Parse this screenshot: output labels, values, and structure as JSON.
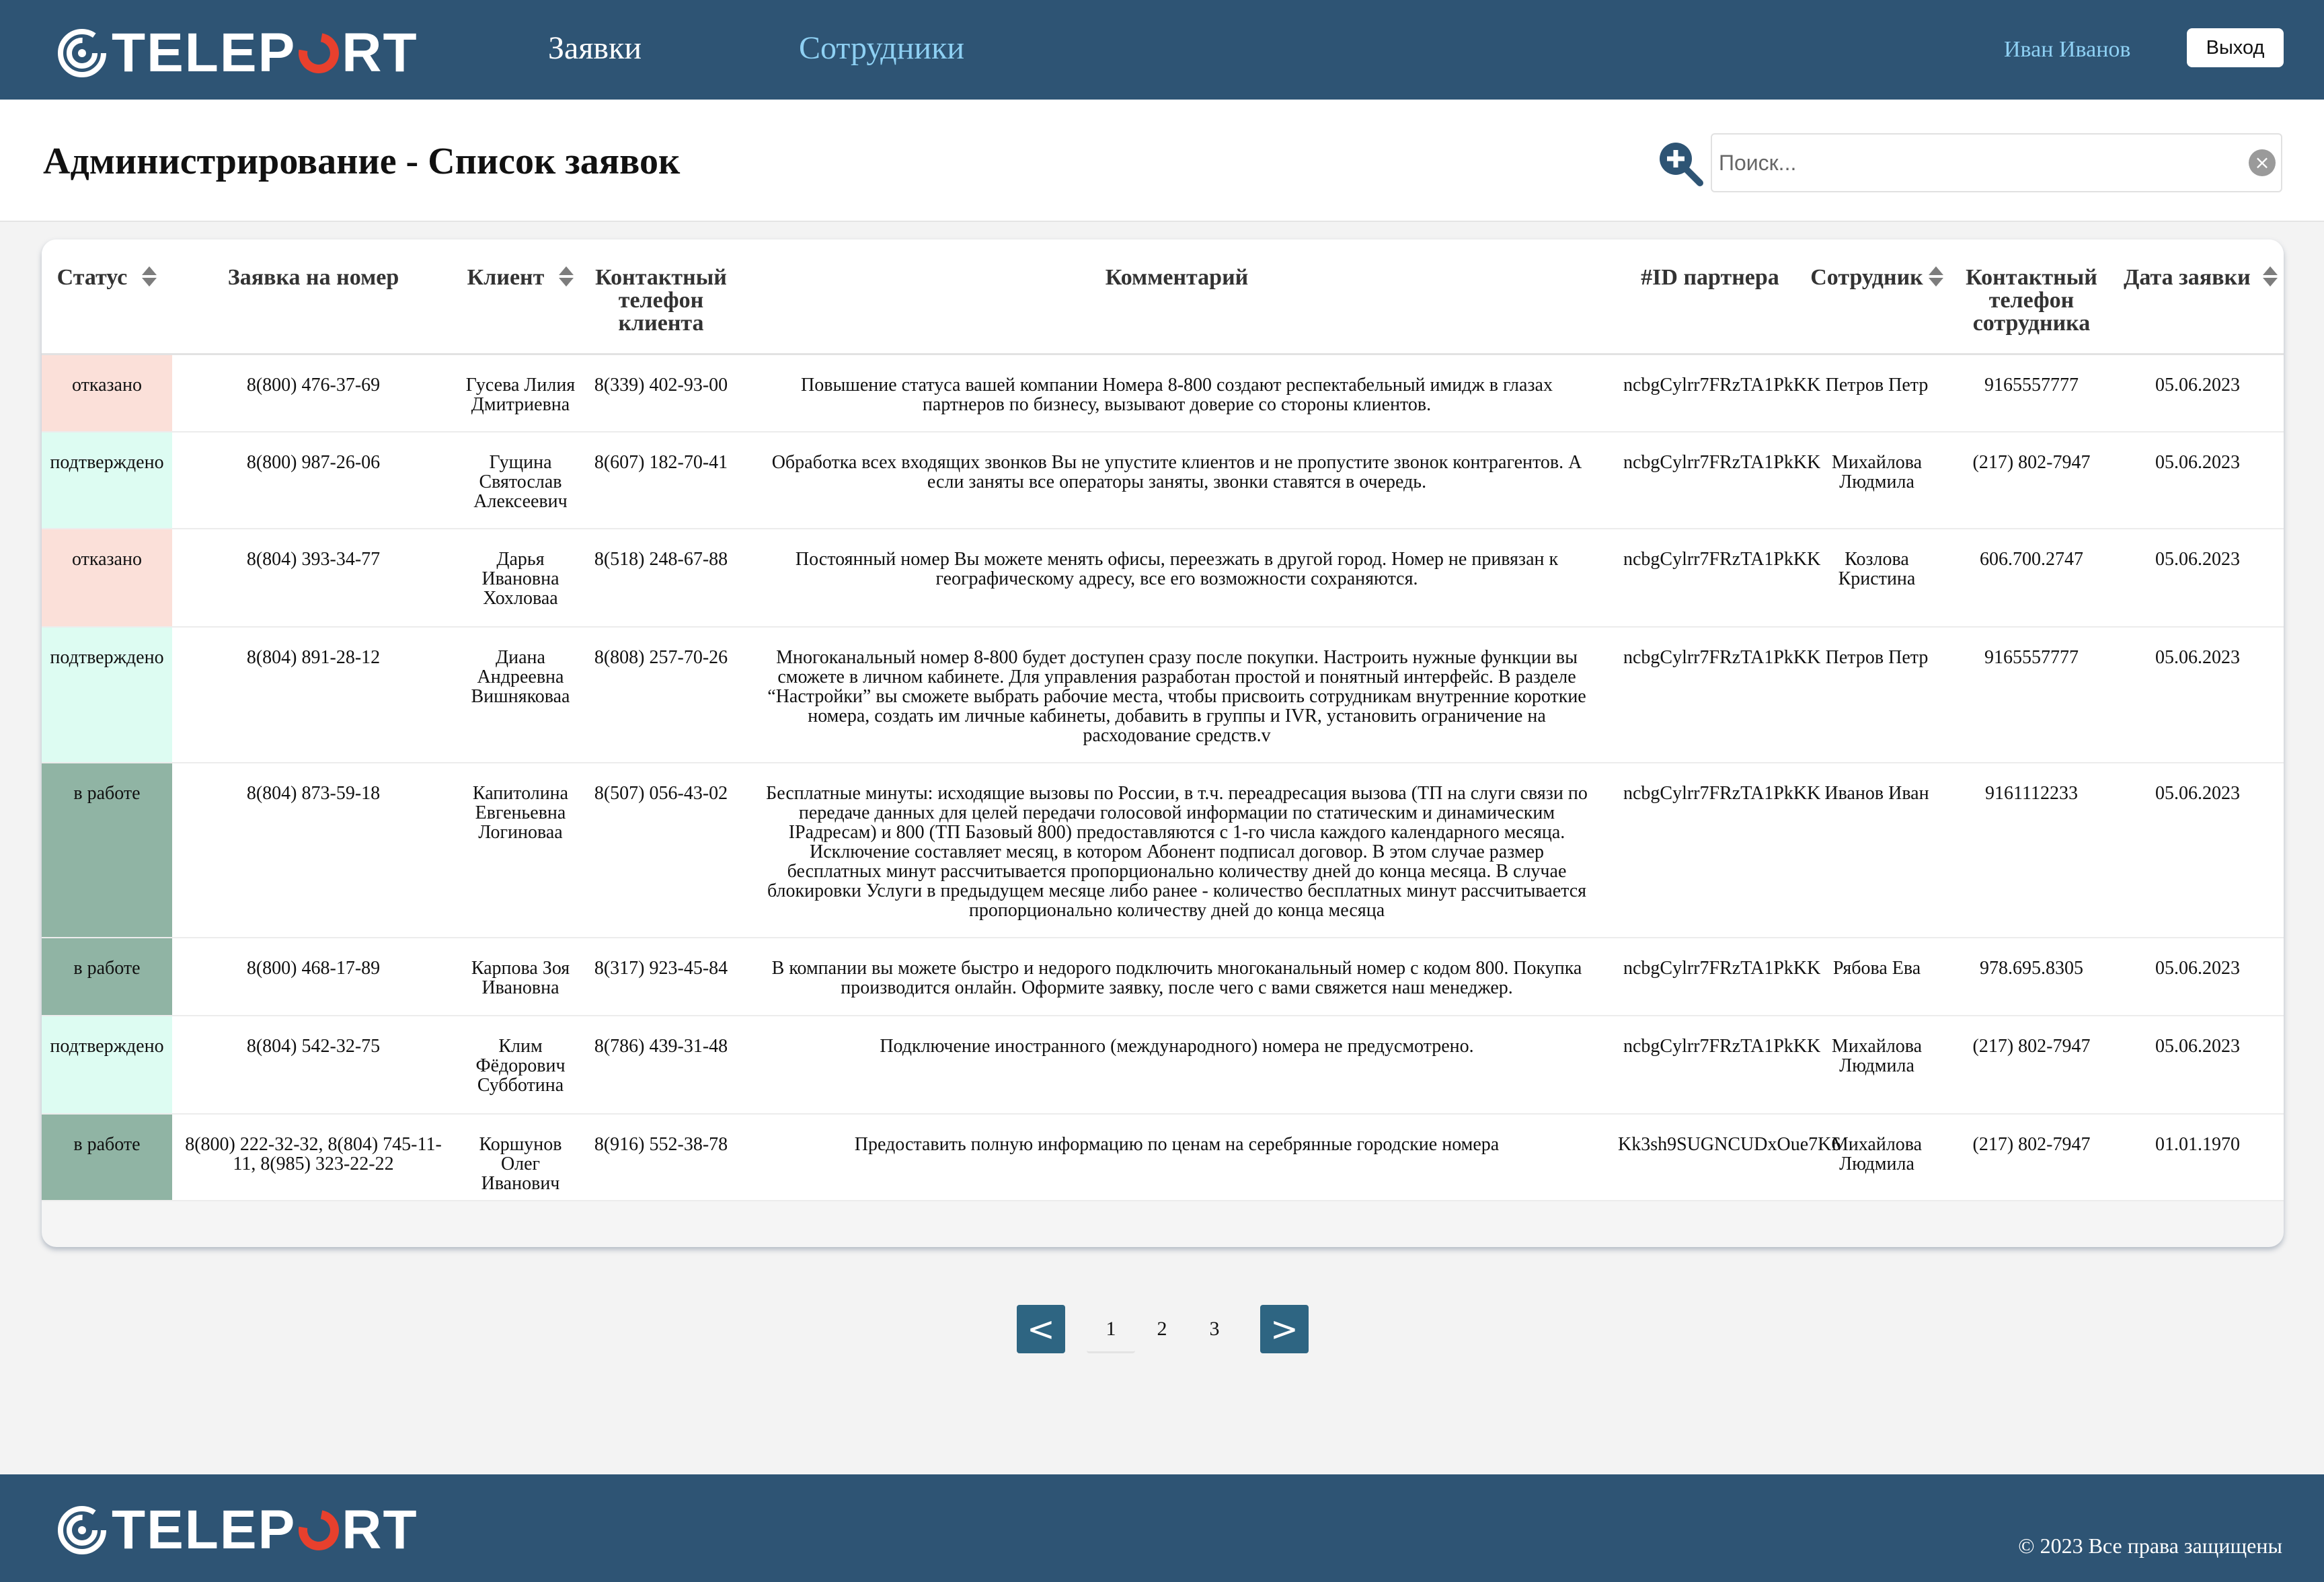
{
  "header": {
    "logo_text": "TELEPORT",
    "nav": {
      "requests": "Заявки",
      "employees": "Сотрудники"
    },
    "user_name": "Иван Иванов",
    "logout_label": "Выход"
  },
  "page": {
    "title": "Администрирование - Список заявок",
    "search_placeholder": "Поиск...",
    "add_icon": "plus-magnifier-icon",
    "clear_icon": "clear-circle-icon"
  },
  "table": {
    "columns": {
      "status": "Статус",
      "number": "Заявка на номер",
      "client": "Клиент",
      "client_phone": "Контактный телефон клиента",
      "comment": "Комментарий",
      "partner_id": "#ID партнера",
      "employee": "Сотрудник",
      "employee_phone": "Контактный телефон сотрудника",
      "date": "Дата заявки"
    },
    "rows": [
      {
        "status": "отказано",
        "number": "8(800) 476-37-69",
        "client": "Гусева Лилия Дмитриевна",
        "client_phone": "8(339) 402-93-00",
        "comment": "Повышение статуса вашей компании Номера 8-800 создают респектабельный имидж в глазах партнеров по бизнесу, вызывают доверие со стороны клиентов.",
        "partner_id": "ncbgCylrr7FRzTA1PkKK",
        "employee": "Петров Петр",
        "employee_phone": "9165557777",
        "date": "05.06.2023"
      },
      {
        "status": "подтверждено",
        "number": "8(800) 987-26-06",
        "client": "Гущина Святослав Алексеевич",
        "client_phone": "8(607) 182-70-41",
        "comment": "Обработка всех входящих звонков Вы не упустите клиентов и не пропустите звонок контрагентов. А если заняты все операторы заняты, звонки ставятся в очередь.",
        "partner_id": "ncbgCylrr7FRzTA1PkKK",
        "employee": "Михайлова Людмила",
        "employee_phone": "(217) 802-7947",
        "date": "05.06.2023"
      },
      {
        "status": "отказано",
        "number": "8(804) 393-34-77",
        "client": "Дарья Ивановна Хохловаа",
        "client_phone": "8(518) 248-67-88",
        "comment": "Постоянный номер Вы можете менять офисы, переезжать в другой город. Номер не привязан к географическому адресу, все его возможности сохраняются.",
        "partner_id": "ncbgCylrr7FRzTA1PkKK",
        "employee": "Козлова Кристина",
        "employee_phone": "606.700.2747",
        "date": "05.06.2023"
      },
      {
        "status": "подтверждено",
        "number": "8(804) 891-28-12",
        "client": "Диана Андреевна Вишняковаа",
        "client_phone": "8(808) 257-70-26",
        "comment": "Многоканальный номер 8-800 будет доступен сразу после покупки. Настроить нужные функции вы сможете в личном кабинете. Для управления разработан простой и понятный интерфейс. В разделе “Настройки” вы сможете выбрать рабочие места, чтобы присвоить сотрудникам внутренние короткие номера, создать им личные кабинеты, добавить в группы и IVR, установить ограничение на расходование средств.v",
        "partner_id": "ncbgCylrr7FRzTA1PkKK",
        "employee": "Петров Петр",
        "employee_phone": "9165557777",
        "date": "05.06.2023"
      },
      {
        "status": "в работе",
        "number": "8(804) 873-59-18",
        "client": "Капитолина Евгеньевна Логиноваа",
        "client_phone": "8(507) 056-43-02",
        "comment": "Бесплатные минуты: исходящие вызовы по России, в т.ч. переадресация вызова (ТП на слуги связи по передаче данных для целей передачи голосовой информации по статическим и динамическим IPадресам) и 800 (ТП Базовый 800) предоставляются с 1-го числа каждого календарного месяца. Исключение составляет месяц, в котором Абонент подписал договор. В этом случае размер бесплатных минут рассчитывается пропорционально количеству дней до конца месяца. В случае блокировки Услуги в предыдущем месяце либо ранее - количество бесплатных минут рассчитывается пропорционально количеству дней до конца месяца",
        "partner_id": "ncbgCylrr7FRzTA1PkKK",
        "employee": "Иванов Иван",
        "employee_phone": "9161112233",
        "date": "05.06.2023"
      },
      {
        "status": "в работе",
        "number": "8(800) 468-17-89",
        "client": "Карпова Зоя Ивановна",
        "client_phone": "8(317) 923-45-84",
        "comment": "В компании вы можете быстро и недорого подключить многоканальный номер с кодом 800. Покупка производится онлайн. Оформите заявку, после чего с вами свяжется наш менеджер.",
        "partner_id": "ncbgCylrr7FRzTA1PkKK",
        "employee": "Рябова Ева",
        "employee_phone": "978.695.8305",
        "date": "05.06.2023"
      },
      {
        "status": "подтверждено",
        "number": "8(804) 542-32-75",
        "client": "Клим Фёдорович Субботина",
        "client_phone": "8(786) 439-31-48",
        "comment": "Подключение иностранного (международного) номера не предусмотрено.",
        "partner_id": "ncbgCylrr7FRzTA1PkKK",
        "employee": "Михайлова Людмила",
        "employee_phone": "(217) 802-7947",
        "date": "05.06.2023"
      },
      {
        "status": "в работе",
        "number": "8(800) 222-32-32, 8(804) 745-11-11, 8(985) 323-22-22",
        "client": "Коршунов Олег Иванович",
        "client_phone": "8(916) 552-38-78",
        "comment": "Предоставить полную информацию по ценам на серебрянные городские номера",
        "partner_id": "Kk3sh9SUGNCUDxOue7K6",
        "employee": "Михайлова Людмила",
        "employee_phone": "(217) 802-7947",
        "date": "01.01.1970"
      }
    ]
  },
  "pagination": {
    "prev": "<",
    "next": ">",
    "pages": [
      "1",
      "2",
      "3"
    ],
    "current": "1"
  },
  "footer": {
    "logo_text": "TELEPORT",
    "copyright": "© 2023 Все права защищены"
  },
  "colors": {
    "header_bg": "#2e5474",
    "accent_light_blue": "#8ed0f3",
    "logo_o": "#e8402d",
    "status_refused": "#fbe0d9",
    "status_confirmed": "#ddfcf2",
    "status_in_work": "#90b4a4",
    "pager": "#2e6582"
  }
}
